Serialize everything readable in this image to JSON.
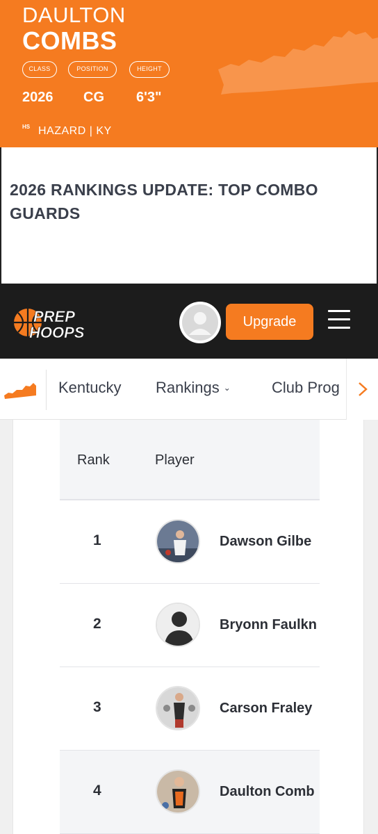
{
  "player_card": {
    "first_name": "DAULTON",
    "last_name": "COMBS",
    "labels": {
      "class": "CLASS",
      "position": "POSITION",
      "height": "HEIGHT"
    },
    "class": "2026",
    "position": "CG",
    "height": "6'3\"",
    "hs_label": "HS",
    "school": "HAZARD | KY"
  },
  "article": {
    "headline": "2026 RANKINGS UPDATE: TOP COMBO GUARDS"
  },
  "header": {
    "logo_text_top": "PREP",
    "logo_text_bottom": "HOOPS",
    "upgrade_label": "Upgrade"
  },
  "subnav": {
    "items": [
      "Kentucky",
      "Rankings",
      "Club Prog"
    ],
    "rankings_chevron": "⌄"
  },
  "rankings_table": {
    "columns": [
      "Rank",
      "Player"
    ],
    "rows": [
      {
        "rank": "1",
        "player": "Dawson Gilbe"
      },
      {
        "rank": "2",
        "player": "Bryonn Faulkn"
      },
      {
        "rank": "3",
        "player": "Carson Fraley"
      },
      {
        "rank": "4",
        "player": "Daulton Comb"
      }
    ]
  },
  "colors": {
    "brand_orange": "#f57b20",
    "header_dark": "#1c1c1c",
    "text_dark": "#2c2f36"
  },
  "icons": {
    "state": "kentucky-state-icon",
    "next": "chevron-right-icon",
    "menu": "hamburger-menu-icon",
    "avatar": "user-avatar-icon"
  }
}
